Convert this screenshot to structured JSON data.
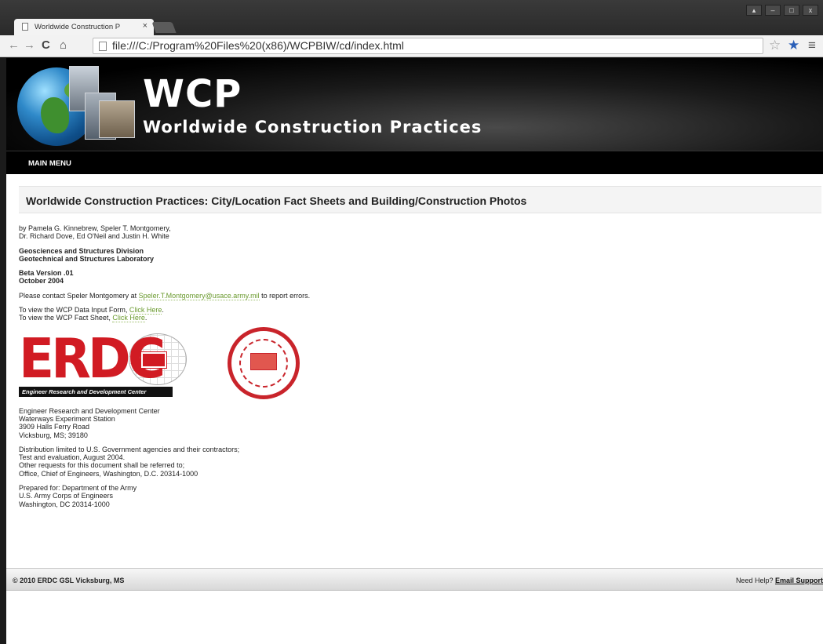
{
  "browser": {
    "tab_title": "Worldwide Construction P",
    "url": "file:///C:/Program%20Files%20(x86)/WCPBIW/cd/index.html",
    "nav_icons": [
      "back-icon",
      "forward-icon",
      "reload-icon",
      "home-icon"
    ],
    "toolbar_icons": [
      "star-outline-icon",
      "star-filled-icon",
      "menu-icon"
    ]
  },
  "banner": {
    "title": "WCP",
    "subtitle": "Worldwide Construction Practices"
  },
  "menu": {
    "main_menu": "MAIN MENU"
  },
  "page": {
    "title": "Worldwide Construction Practices: City/Location Fact Sheets and Building/Construction Photos",
    "authors": [
      "by Pamela G. Kinnebrew, Speler T. Montgomery,",
      "Dr. Richard Dove, Ed O'Neil and Justin H. White"
    ],
    "division": [
      "Geosciences and Structures Division",
      "Geotechnical and Structures Laboratory"
    ],
    "version": [
      "Beta Version .01",
      "October 2004"
    ],
    "contact": {
      "prefix": "Please contact Speler Montgomery at ",
      "email": "Speler.T.Montgomery@usace.army.mil",
      "suffix": " to report errors."
    },
    "links": {
      "form_prefix": "To view the WCP Data Input Form, ",
      "form_link": "Click Here",
      "form_suffix": ".",
      "sheet_prefix": "To view the WCP Fact Sheet, ",
      "sheet_link": "Click Here",
      "sheet_suffix": "."
    },
    "erdc_logo": {
      "letters": "ERDC",
      "tagline": "Engineer Research and Development Center"
    },
    "address": [
      "Engineer Research and Development Center",
      "Waterways Experiment Station",
      "3909 Halls Ferry Road",
      "Vicksburg, MS; 39180"
    ],
    "distribution": [
      "Distribution limited to U.S. Government agencies and their contractors;",
      "Test and evaluation, August 2004.",
      "Other requests for this document shall be referred to;",
      "Office, Chief of Engineers, Washington, D.C. 20314-1000"
    ],
    "prepared": [
      "Prepared for: Department of the Army",
      "U.S. Army Corps of Engineers",
      "Washington, DC 20314-1000"
    ]
  },
  "footer": {
    "copyright": "© 2010 ERDC GSL Vicksburg, MS",
    "help_prefix": "Need Help? ",
    "help_link": "Email Support"
  },
  "colors": {
    "link_green": "#6a9a2e",
    "erdc_red": "#d11b23",
    "banner_black": "#000000"
  }
}
